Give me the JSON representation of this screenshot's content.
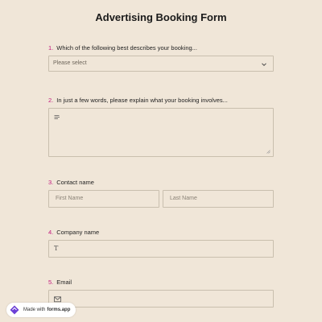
{
  "form": {
    "title": "Advertising Booking Form"
  },
  "questions": [
    {
      "number": "1.",
      "label": "Which of the following best describes your booking...",
      "type": "select",
      "value": "Please select"
    },
    {
      "number": "2.",
      "label": "In just a few words, please explain what your booking involves...",
      "type": "textarea",
      "value": ""
    },
    {
      "number": "3.",
      "label": "Contact name",
      "type": "name",
      "first_placeholder": "First Name",
      "last_placeholder": "Last Name"
    },
    {
      "number": "4.",
      "label": "Company name",
      "type": "text",
      "value": ""
    },
    {
      "number": "5.",
      "label": "Email",
      "type": "email",
      "value": ""
    }
  ],
  "footer_badge": {
    "prefix": "Made with",
    "brand": "forms.app"
  },
  "colors": {
    "background": "#f0e6d8",
    "question_number": "#c2187c",
    "field_border": "#c9bfae",
    "brand_purple": "#6c3fd6"
  },
  "icons": {
    "select": "chevron-down-icon",
    "textarea": "text-lines-icon",
    "company": "text-type-icon",
    "email": "mail-icon",
    "badge": "forms-app-logo-icon"
  }
}
